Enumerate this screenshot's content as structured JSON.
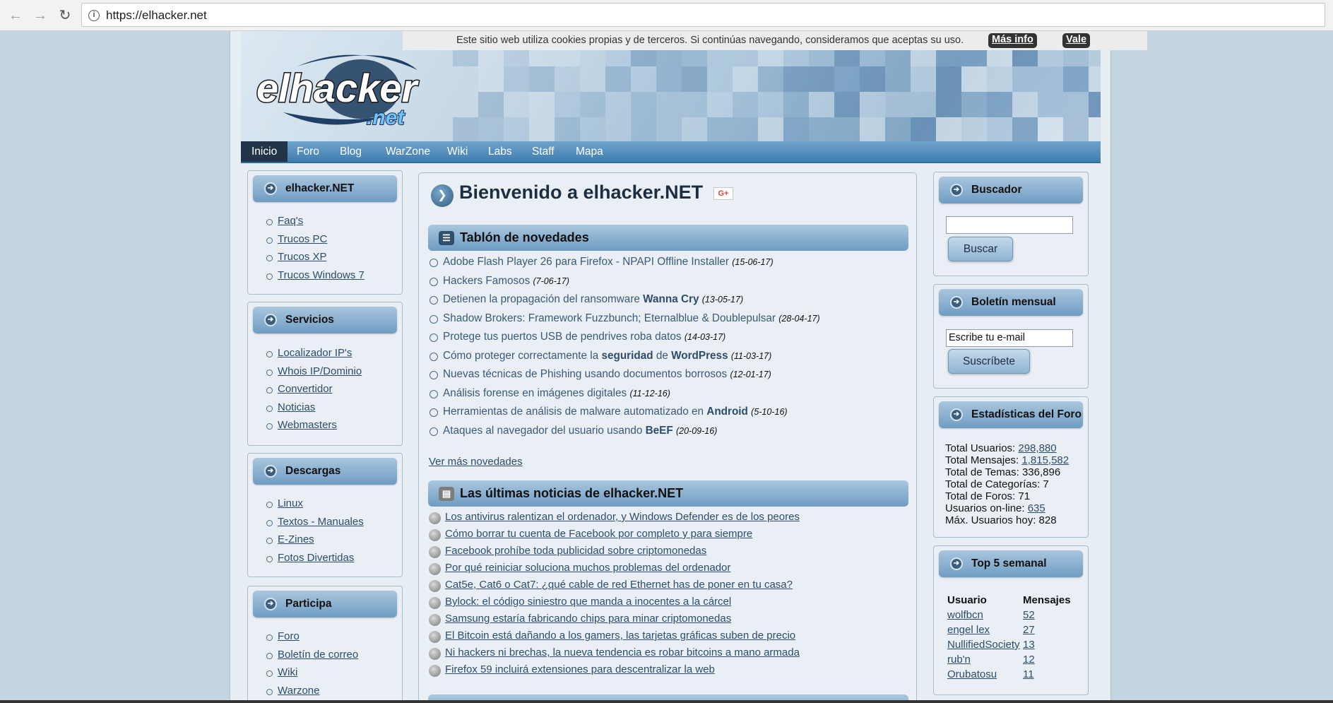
{
  "browser": {
    "url": "https://elhacker.net"
  },
  "cookie_bar": {
    "text": "Este sitio web utiliza cookies propias y de terceros. Si continúas navegando, consideramos que aceptas su uso.",
    "more_label": "Más info",
    "ok_label": "Vale"
  },
  "logo": {
    "main": "elhacker",
    "sub": ".net"
  },
  "menu": [
    {
      "label": "Inicio"
    },
    {
      "label": "Foro"
    },
    {
      "label": "Blog"
    },
    {
      "label": "WarZone"
    },
    {
      "label": "Wiki"
    },
    {
      "label": "Labs"
    },
    {
      "label": "Staff"
    },
    {
      "label": "Mapa"
    }
  ],
  "left": {
    "box1": {
      "title": "elhacker.NET",
      "items": [
        "Faq's",
        "Trucos PC",
        "Trucos XP",
        "Trucos Windows 7"
      ]
    },
    "box2": {
      "title": "Servicios",
      "items": [
        "Localizador IP's",
        "Whois IP/Dominio",
        "Convertidor",
        "Noticias",
        "Webmasters"
      ]
    },
    "box3": {
      "title": "Descargas",
      "items": [
        "Linux",
        "Textos - Manuales",
        "E-Zines",
        "Fotos Divertidas"
      ]
    },
    "box4": {
      "title": "Participa",
      "items": [
        "Foro",
        "Boletín de correo",
        "Wiki",
        "Warzone"
      ]
    }
  },
  "main": {
    "title": "Bienvenido a elhacker.NET",
    "gplus": "G+",
    "novedades_title": "Tablón de novedades",
    "novedades": [
      {
        "a": "Adobe Flash Player 26 para Firefox - NPAPI Offline Installer ",
        "date": "(15-06-17)"
      },
      {
        "a": "Hackers Famosos ",
        "date": "(7-06-17)"
      },
      {
        "a": "Detienen la propagación del ransomware ",
        "b": "Wanna Cry",
        "c": " ",
        "date": "(13-05-17)"
      },
      {
        "a": "Shadow Brokers: Framework Fuzzbunch; Eternalblue & Doublepulsar ",
        "date": "(28-04-17)"
      },
      {
        "a": "Protege tus puertos USB de pendrives roba datos ",
        "date": "(14-03-17)"
      },
      {
        "a": "Cómo proteger correctamente la ",
        "b": "seguridad",
        "c": " de ",
        "d": "WordPress",
        "e": " ",
        "date": "(11-03-17)"
      },
      {
        "a": "Nuevas técnicas de Phishing usando documentos borrosos ",
        "date": "(12-01-17)"
      },
      {
        "a": "Análisis forense en imágenes digitales ",
        "date": "(11-12-16)"
      },
      {
        "a": "Herramientas de análisis de malware automatizado en ",
        "b": "Android",
        "c": " ",
        "date": "(5-10-16)"
      },
      {
        "a": "Ataques al navegador del usuario usando ",
        "b": "BeEF",
        "c": " ",
        "date": "(20-09-16)"
      }
    ],
    "more_label": "Ver más novedades",
    "latest_title": "Las últimas noticias de elhacker.NET",
    "latest": [
      "Los antivirus ralentizan el ordenador, y Windows Defender es de los peores",
      "Cómo borrar tu cuenta de Facebook por completo y para siempre",
      "Facebook prohíbe toda publicidad sobre criptomonedas",
      "Por qué reiniciar soluciona muchos problemas del ordenador",
      "Cat5e, Cat6 o Cat7: ¿qué cable de red Ethernet has de poner en tu casa?",
      "Bylock: el código siniestro que manda a inocentes a la cárcel",
      "Samsung estaría fabricando chips para minar criptomonedas",
      "El Bitcoin está dañando a los gamers, las tarjetas gráficas suben de precio",
      "Ni hackers ni brechas, la nueva tendencia es robar bitcoins a mano armada",
      "Firefox 59 incluirá extensiones para descentralizar la web"
    ]
  },
  "right": {
    "search": {
      "title": "Buscador",
      "value": "",
      "button": "Buscar"
    },
    "newsletter": {
      "title": "Boletín mensual",
      "value": "Escribe tu e-mail",
      "button": "Suscríbete"
    },
    "stats": {
      "title": "Estadísticas del Foro",
      "rows": [
        {
          "label": "Total Usuarios: ",
          "value": "298,880",
          "link": true
        },
        {
          "label": "Total Mensajes: ",
          "value": "1,815,582",
          "link": true
        },
        {
          "label": "Total de Temas: ",
          "value": "336,896",
          "link": false
        },
        {
          "label": "Total de Categorías: ",
          "value": "7",
          "link": false
        },
        {
          "label": "Total de Foros: ",
          "value": "71",
          "link": false
        },
        {
          "label": "Usuarios on-line: ",
          "value": "635",
          "link": true
        },
        {
          "label": "Máx. Usuarios hoy: ",
          "value": "828",
          "link": false
        }
      ]
    },
    "top5": {
      "title": "Top 5 semanal",
      "col_user": "Usuario",
      "col_msgs": "Mensajes",
      "rows": [
        {
          "user": "wolfbcn",
          "msgs": "52"
        },
        {
          "user": "engel lex",
          "msgs": "27"
        },
        {
          "user": "NullifiedSociety",
          "msgs": "13"
        },
        {
          "user": "rub'n",
          "msgs": "12"
        },
        {
          "user": "Orubatosu",
          "msgs": "11"
        }
      ]
    }
  }
}
